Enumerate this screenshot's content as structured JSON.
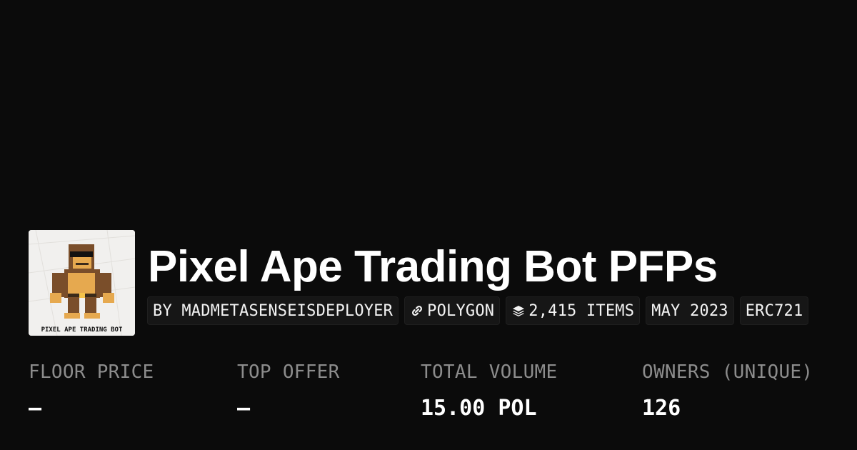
{
  "collection": {
    "title": "Pixel Ape Trading Bot PFPs",
    "logo_caption": "PIXEL APE TRADING BOT"
  },
  "chips": [
    {
      "label": "BY MADMETASENSEISDEPLOYER"
    },
    {
      "label": "POLYGON",
      "icon": "link-icon"
    },
    {
      "label": "2,415 ITEMS",
      "icon": "layers-icon"
    },
    {
      "label": "MAY 2023"
    },
    {
      "label": "ERC721"
    }
  ],
  "stats": [
    {
      "label": "FLOOR PRICE",
      "value": "–"
    },
    {
      "label": "TOP OFFER",
      "value": "–"
    },
    {
      "label": "TOTAL VOLUME",
      "value": "15.00 POL"
    },
    {
      "label": "OWNERS (UNIQUE)",
      "value": "126"
    }
  ],
  "colors": {
    "background": "#0b0b0b",
    "chip_background": "#161616",
    "label_gray": "#8c8c8c",
    "text": "#ffffff"
  }
}
